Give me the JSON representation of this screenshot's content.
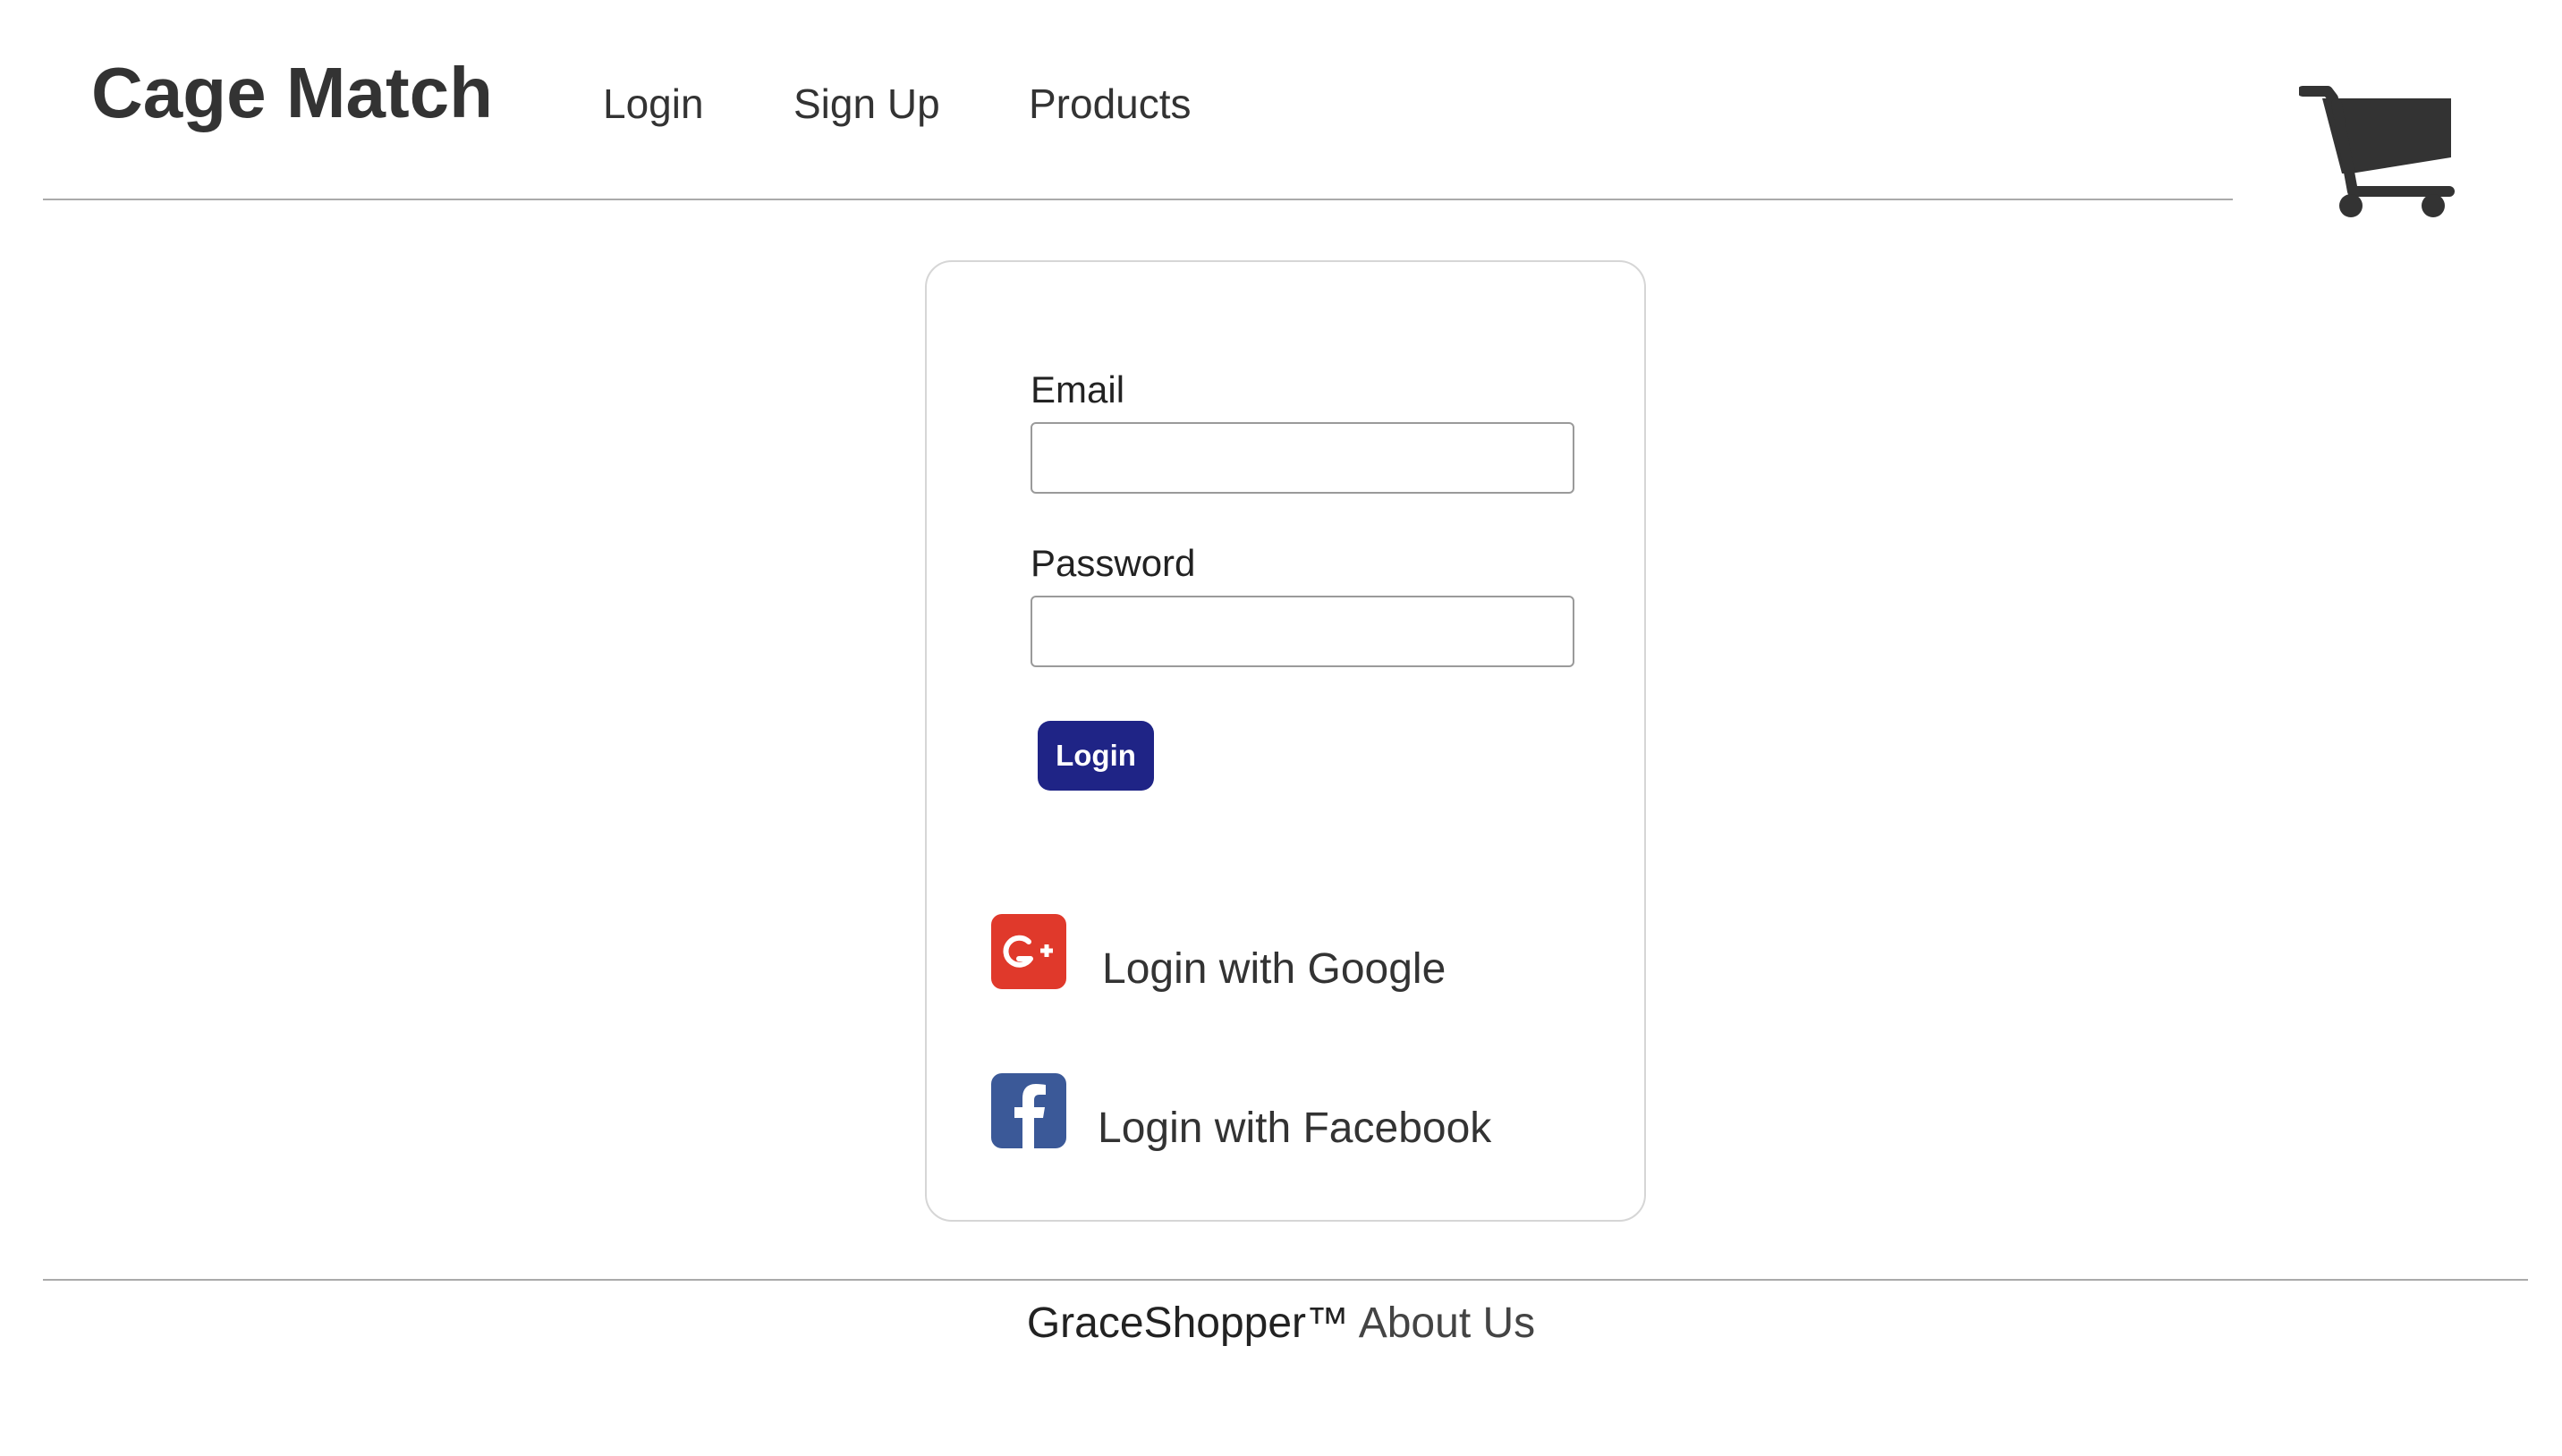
{
  "header": {
    "brand": "Cage Match",
    "nav": {
      "login": "Login",
      "signup": "Sign Up",
      "products": "Products"
    },
    "cart_icon": "shopping-cart-icon"
  },
  "login_form": {
    "email_label": "Email",
    "email_value": "",
    "password_label": "Password",
    "password_value": "",
    "submit_label": "Login",
    "submit_color": "#1f2486"
  },
  "oauth": {
    "google": {
      "label": "Login with Google",
      "icon": "google-plus-icon",
      "color": "#e0392b"
    },
    "facebook": {
      "label": "Login with Facebook",
      "icon": "facebook-icon",
      "color": "#3b5998"
    }
  },
  "footer": {
    "brand": "GraceShopper™",
    "about": "About Us"
  }
}
